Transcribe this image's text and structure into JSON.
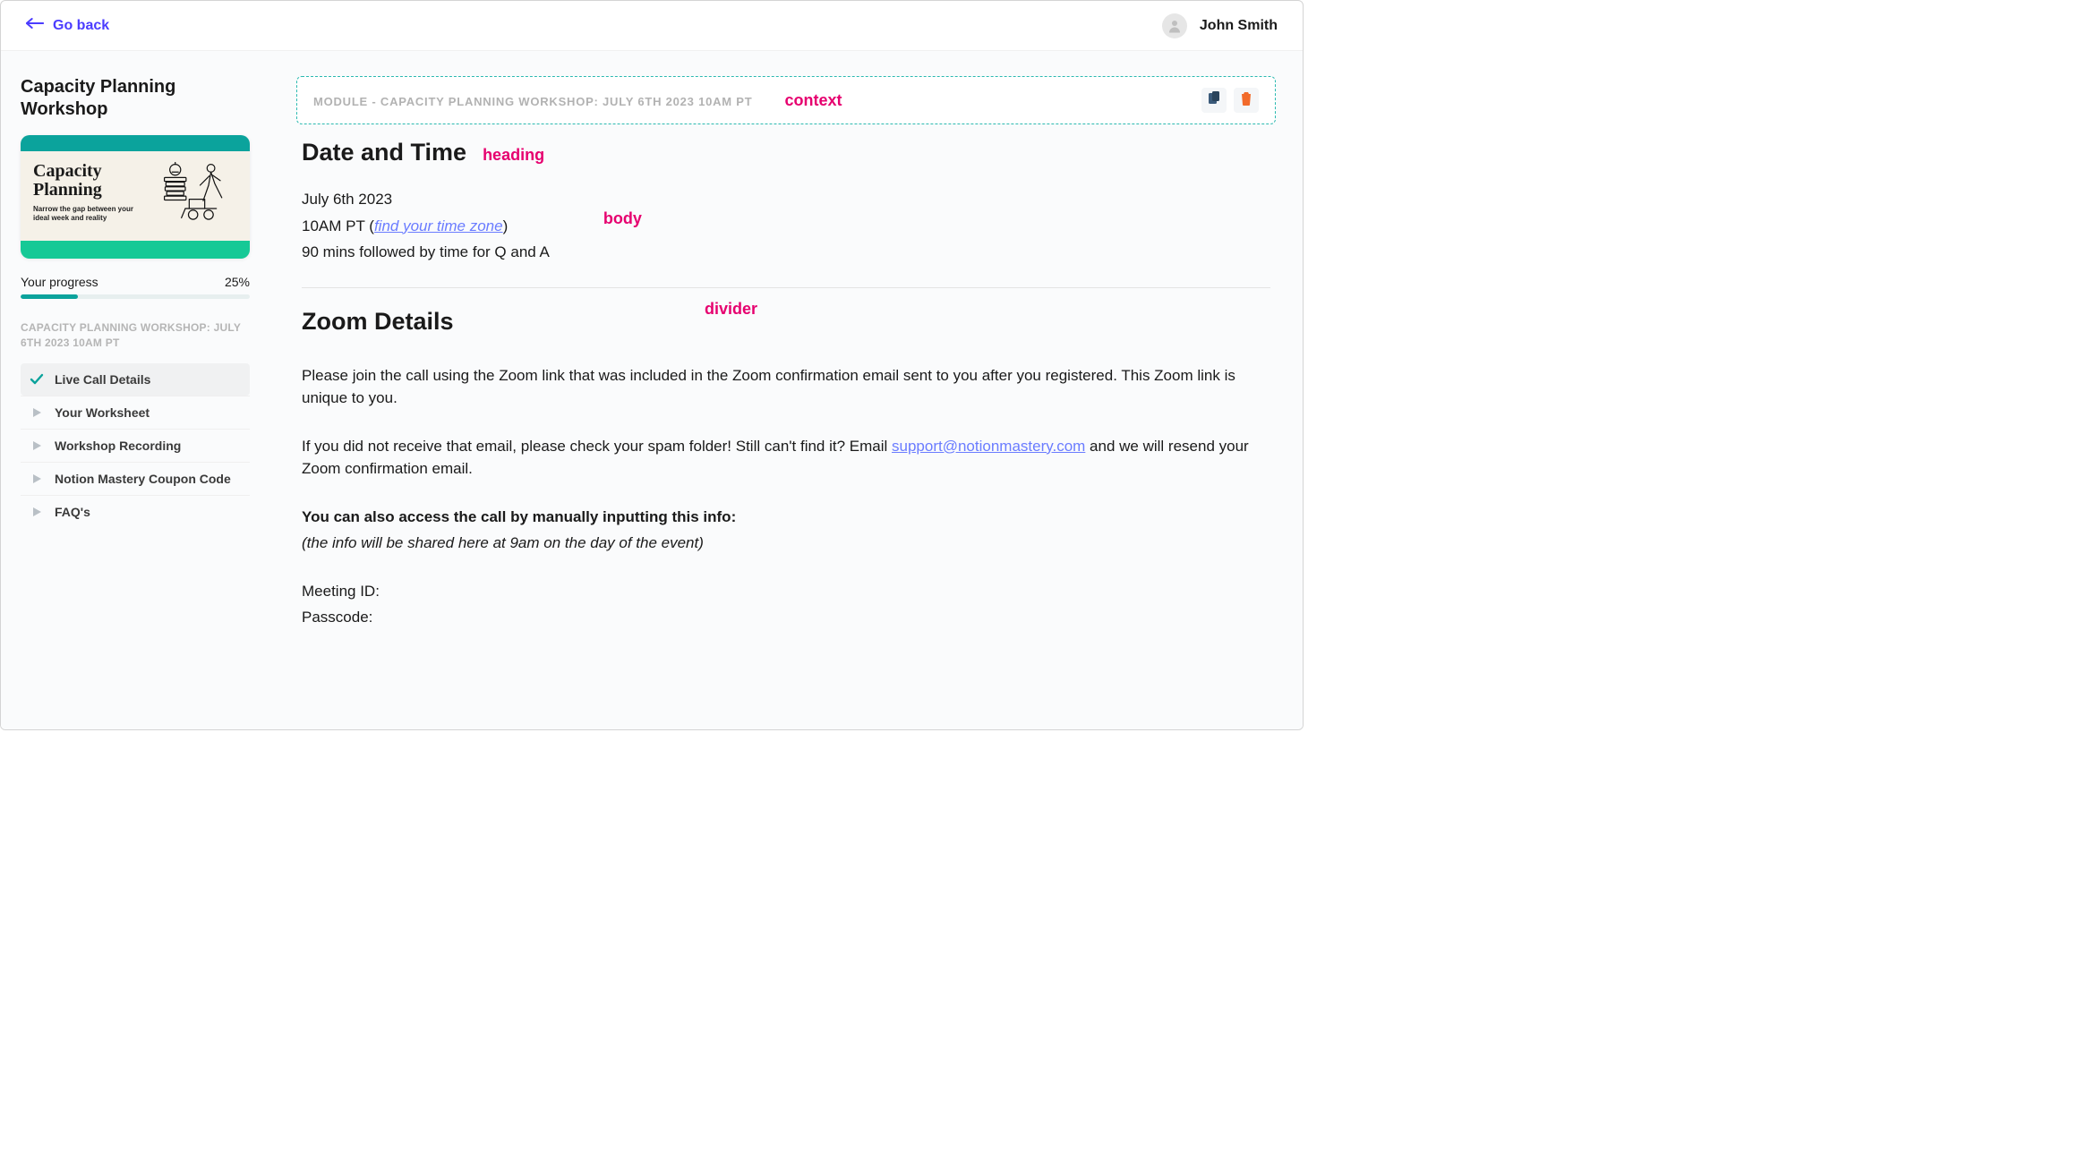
{
  "topbar": {
    "go_back_label": "Go back",
    "user_name": "John Smith"
  },
  "sidebar": {
    "title": "Capacity Planning Workshop",
    "cover": {
      "heading": "Capacity Planning",
      "subheading": "Narrow the gap between your ideal week and reality"
    },
    "progress_label": "Your progress",
    "progress_value": "25%",
    "progress_pct": 25,
    "module_label": "CAPACITY PLANNING WORKSHOP: JULY 6TH 2023 10AM PT",
    "items": [
      {
        "label": "Live Call Details",
        "icon": "check",
        "active": true
      },
      {
        "label": "Your Worksheet",
        "icon": "play",
        "active": false
      },
      {
        "label": "Workshop Recording",
        "icon": "play",
        "active": false
      },
      {
        "label": "Notion Mastery Coupon Code",
        "icon": "play",
        "active": false
      },
      {
        "label": "FAQ's",
        "icon": "play",
        "active": false
      }
    ]
  },
  "main": {
    "context_label": "MODULE - CAPACITY PLANNING WORKSHOP: JULY 6TH 2023 10AM PT",
    "annotations": {
      "context": "context",
      "heading": "heading",
      "body": "body",
      "divider": "divider"
    },
    "section1": {
      "heading": "Date and Time",
      "date_line": "July 6th 2023",
      "time_prefix": "10AM PT (",
      "time_link": "find your time zone",
      "time_suffix": ")",
      "duration": "90 mins followed by time for Q and A"
    },
    "section2": {
      "heading": "Zoom Details",
      "p1": "Please join the call using the Zoom link that was included in the Zoom confirmation email sent to you after you registered. This Zoom link is unique to you.",
      "p2_a": "If you did not receive that email, please check your spam folder! Still can't find it? Email ",
      "p2_link": "support@notionmastery.com",
      "p2_b": " and we will resend your Zoom confirmation email.",
      "p3_bold": "You can also access the call by manually inputting this info:",
      "p3_ital": "(the info will be shared here at 9am on the day of the event)",
      "meeting_id_label": "Meeting ID:",
      "passcode_label": "Passcode:"
    }
  }
}
